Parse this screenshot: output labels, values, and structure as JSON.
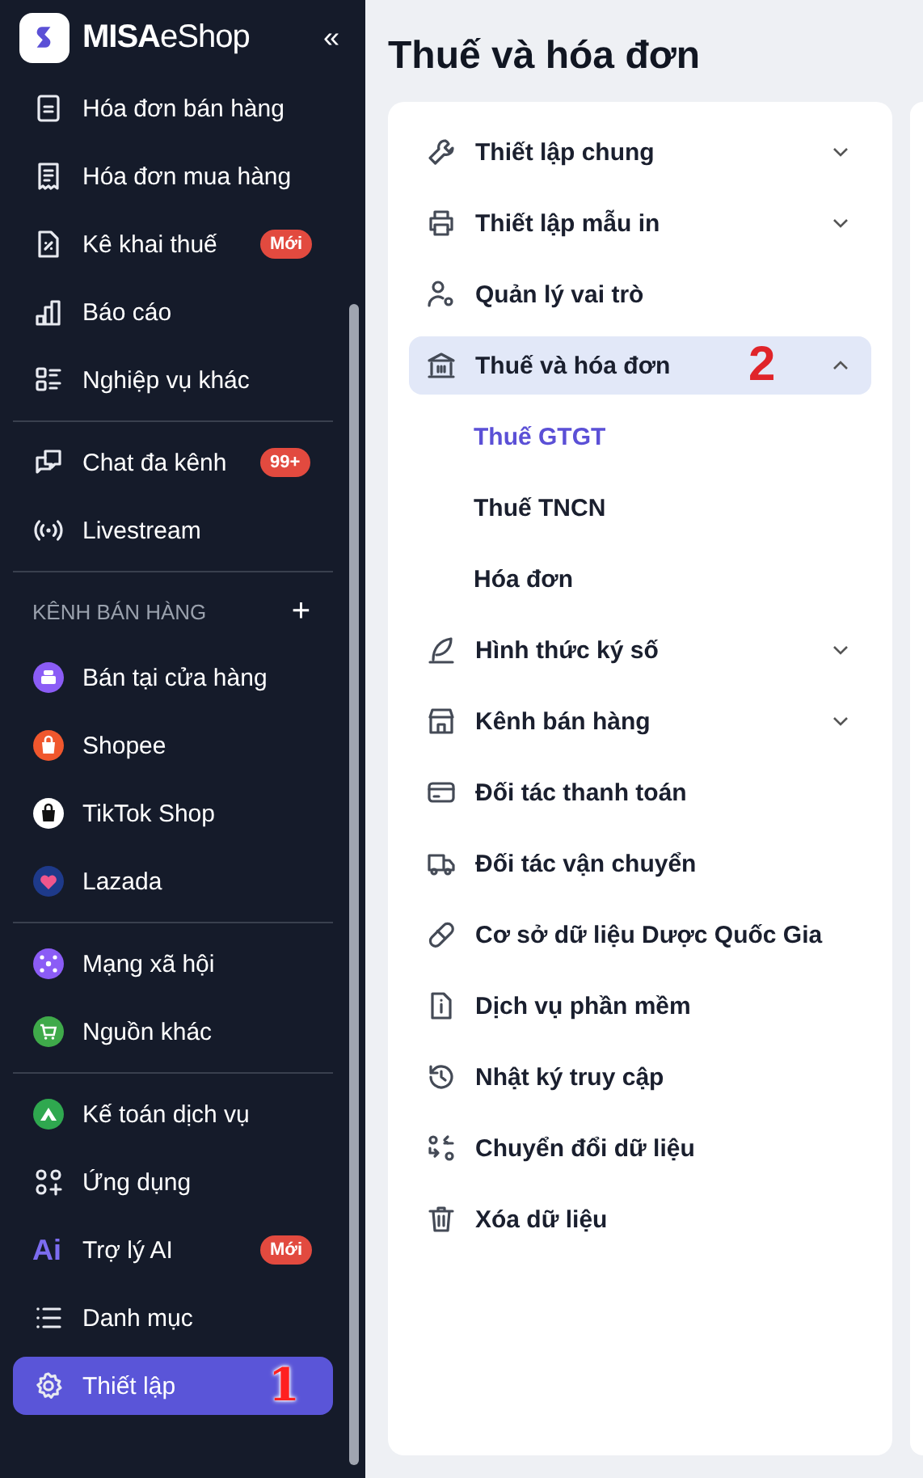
{
  "app": {
    "brand": "MISA",
    "brand_suffix": "eShop",
    "collapse": "«"
  },
  "sidebar": {
    "sections": [
      {
        "items": [
          {
            "label": "Hóa đơn bán hàng",
            "selected": false
          },
          {
            "label": "Hóa đơn mua hàng",
            "selected": false
          },
          {
            "label": "Kê khai thuế",
            "badge": "Mới",
            "selected": false
          },
          {
            "label": "Báo cáo",
            "selected": false
          },
          {
            "label": "Nghiệp vụ khác",
            "selected": false
          }
        ]
      },
      {
        "items": [
          {
            "label": "Chat đa kênh",
            "badge": "99+",
            "selected": false
          },
          {
            "label": "Livestream",
            "selected": false
          }
        ]
      },
      {
        "title": "KÊNH BÁN HÀNG",
        "action": "+",
        "items": [
          {
            "label": "Bán tại cửa hàng",
            "selected": false
          },
          {
            "label": "Shopee",
            "selected": false
          },
          {
            "label": "TikTok Shop",
            "selected": false
          },
          {
            "label": "Lazada",
            "selected": false
          }
        ]
      },
      {
        "items": [
          {
            "label": "Mạng xã hội",
            "selected": false
          },
          {
            "label": "Nguồn khác",
            "selected": false
          }
        ]
      },
      {
        "items": [
          {
            "label": "Kế toán dịch vụ",
            "selected": false
          },
          {
            "label": "Ứng dụng",
            "selected": false
          },
          {
            "label": "Trợ lý AI",
            "icon_text": "Ai",
            "badge": "Mới",
            "selected": false
          },
          {
            "label": "Danh mục",
            "selected": false
          },
          {
            "label": "Thiết lập",
            "selected": true,
            "annotation": "1"
          }
        ]
      }
    ]
  },
  "page": {
    "title": "Thuế và hóa đơn",
    "menu": [
      {
        "kind": "group",
        "label": "Thiết lập chung",
        "expanded": false,
        "selected": false
      },
      {
        "kind": "group",
        "label": "Thiết lập mẫu in",
        "expanded": false,
        "selected": false
      },
      {
        "kind": "link",
        "label": "Quản lý vai trò",
        "selected": false
      },
      {
        "kind": "group",
        "label": "Thuế và hóa đơn",
        "expanded": true,
        "selected": true,
        "annotation": "2",
        "children": [
          {
            "label": "Thuế GTGT",
            "selected": true
          },
          {
            "label": "Thuế TNCN",
            "selected": false
          },
          {
            "label": "Hóa đơn",
            "selected": false
          }
        ]
      },
      {
        "kind": "group",
        "label": "Hình thức ký số",
        "expanded": false,
        "selected": false
      },
      {
        "kind": "group",
        "label": "Kênh bán hàng",
        "expanded": false,
        "selected": false
      },
      {
        "kind": "link",
        "label": "Đối tác thanh toán",
        "selected": false
      },
      {
        "kind": "link",
        "label": "Đối tác vận chuyển",
        "selected": false
      },
      {
        "kind": "link",
        "label": "Cơ sở dữ liệu Dược Quốc Gia",
        "selected": false
      },
      {
        "kind": "link",
        "label": "Dịch vụ phần mềm",
        "selected": false
      },
      {
        "kind": "link",
        "label": "Nhật ký truy cập",
        "selected": false
      },
      {
        "kind": "link",
        "label": "Chuyển đổi dữ liệu",
        "selected": false
      },
      {
        "kind": "link",
        "label": "Xóa dữ liệu",
        "selected": false
      }
    ]
  }
}
